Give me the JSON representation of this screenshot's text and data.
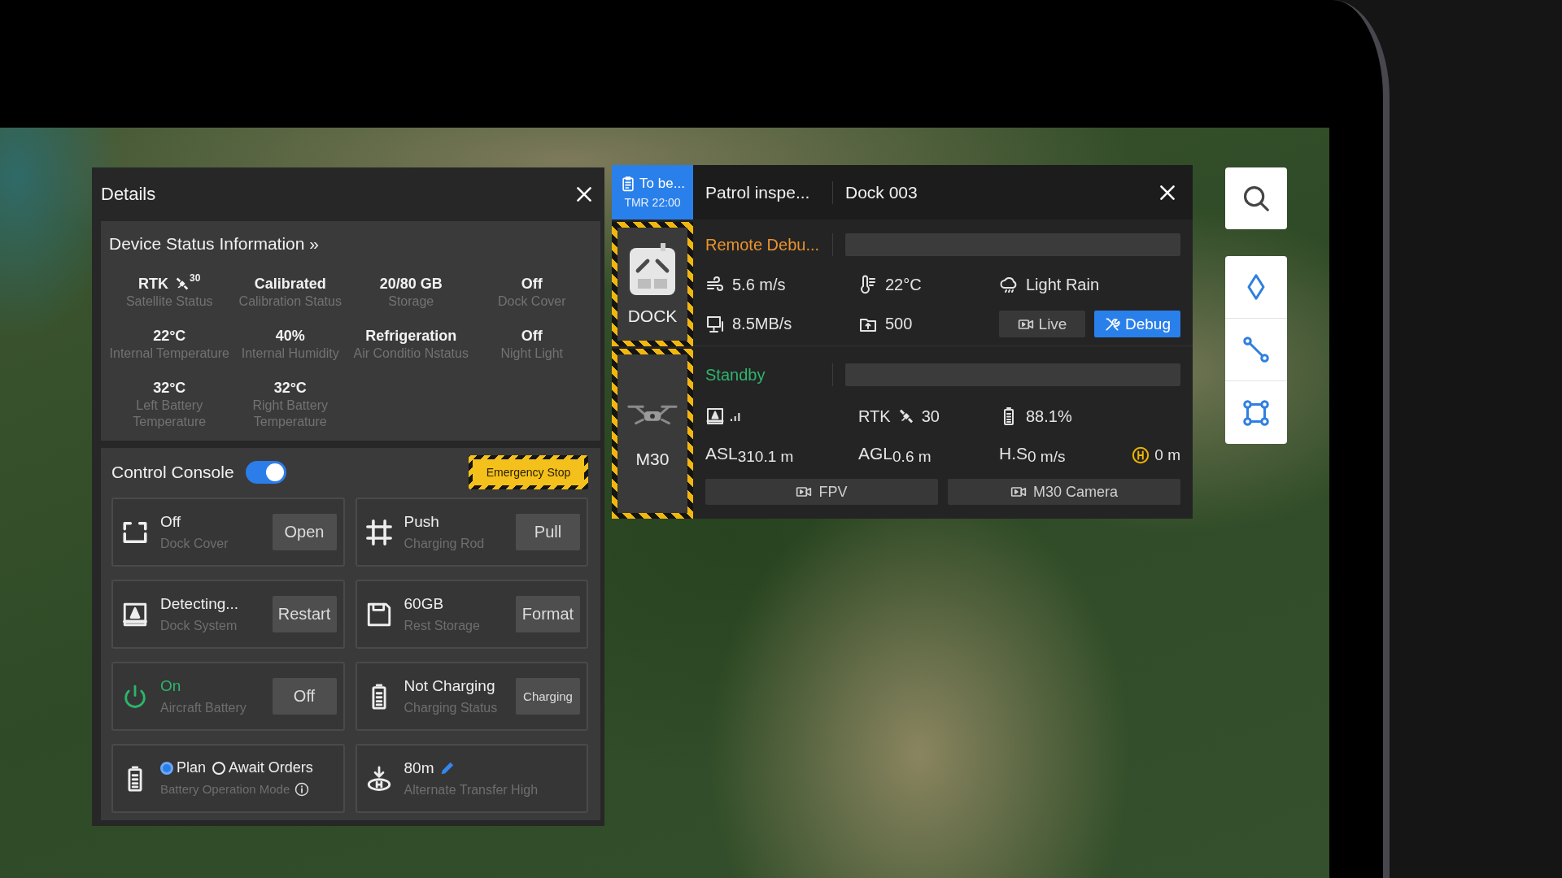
{
  "details": {
    "title": "Details",
    "device_status": {
      "title": "Device Status Information »",
      "items": [
        {
          "kind": "rtk",
          "value": "RTK",
          "count": "30",
          "label": "Satellite Status"
        },
        {
          "kind": "text",
          "value": "Calibrated",
          "label": "Calibration Status"
        },
        {
          "kind": "text",
          "value": "20/80 GB",
          "label": "Storage"
        },
        {
          "kind": "text",
          "value": "Off",
          "label": "Dock Cover"
        },
        {
          "kind": "text",
          "value": "22°C",
          "label": "Internal Temperature"
        },
        {
          "kind": "text",
          "value": "40%",
          "label": "Internal Humidity"
        },
        {
          "kind": "text",
          "value": "Refrigeration",
          "label": "Air Conditio Nstatus"
        },
        {
          "kind": "text",
          "value": "Off",
          "label": "Night Light"
        },
        {
          "kind": "text",
          "value": "32°C",
          "label": "Left Battery Temperature"
        },
        {
          "kind": "text",
          "value": "32°C",
          "label": "Right Battery Temperature"
        }
      ]
    },
    "control_console": {
      "title": "Control Console",
      "enabled": true,
      "emergency_stop": "Emergency Stop",
      "cards": [
        {
          "kind": "action",
          "value": "Off",
          "label": "Dock Cover",
          "button": "Open",
          "color": "#eeeeee"
        },
        {
          "kind": "action",
          "value": "Push",
          "label": "Charging Rod",
          "button": "Pull",
          "color": "#eeeeee"
        },
        {
          "kind": "action",
          "value": "Detecting...",
          "label": "Dock System",
          "button": "Restart",
          "color": "#eeeeee"
        },
        {
          "kind": "action",
          "value": "60GB",
          "label": "Rest Storage",
          "button": "Format",
          "color": "#eeeeee"
        },
        {
          "kind": "action",
          "value": "On",
          "label": "Aircraft Battery",
          "button": "Off",
          "color": "#2db46c"
        },
        {
          "kind": "action",
          "value": "Not Charging",
          "label": "Charging Status",
          "button": "Charging",
          "color": "#eeeeee"
        },
        {
          "kind": "radio",
          "options": [
            {
              "label": "Plan",
              "selected": true
            },
            {
              "label": "Await Orders",
              "selected": false
            }
          ],
          "label": "Battery Operation Mode"
        },
        {
          "kind": "edit",
          "value": "80m",
          "label": "Alternate Transfer High"
        }
      ]
    }
  },
  "task_panel": {
    "badge": {
      "status": "To be...",
      "time": "TMR 22:00"
    },
    "task_name": "Patrol inspe...",
    "device_name": "Dock 003",
    "dock": {
      "name": "DOCK",
      "status": "Remote Debu...",
      "color": "#ea932f",
      "metrics": [
        "5.6 m/s",
        "22°C",
        "Light Rain",
        "8.5MB/s",
        "500"
      ],
      "buttons": [
        {
          "label": "Live",
          "selected": false
        },
        {
          "label": "Debug",
          "selected": true
        }
      ]
    },
    "aircraft": {
      "name": "M30",
      "status": "Standby",
      "color": "#30b46c",
      "rtk": {
        "label": "RTK",
        "count": "30"
      },
      "battery": "88.1%",
      "readouts": [
        {
          "kind": "label",
          "label": "ASL",
          "value": "310.1 m"
        },
        {
          "kind": "label",
          "label": "AGL",
          "value": "0.6 m"
        },
        {
          "kind": "label",
          "label": "H.S",
          "value": "0 m/s"
        },
        {
          "kind": "home",
          "value": "0 m"
        }
      ],
      "buttons": [
        "FPV",
        "M30 Camera"
      ]
    }
  }
}
